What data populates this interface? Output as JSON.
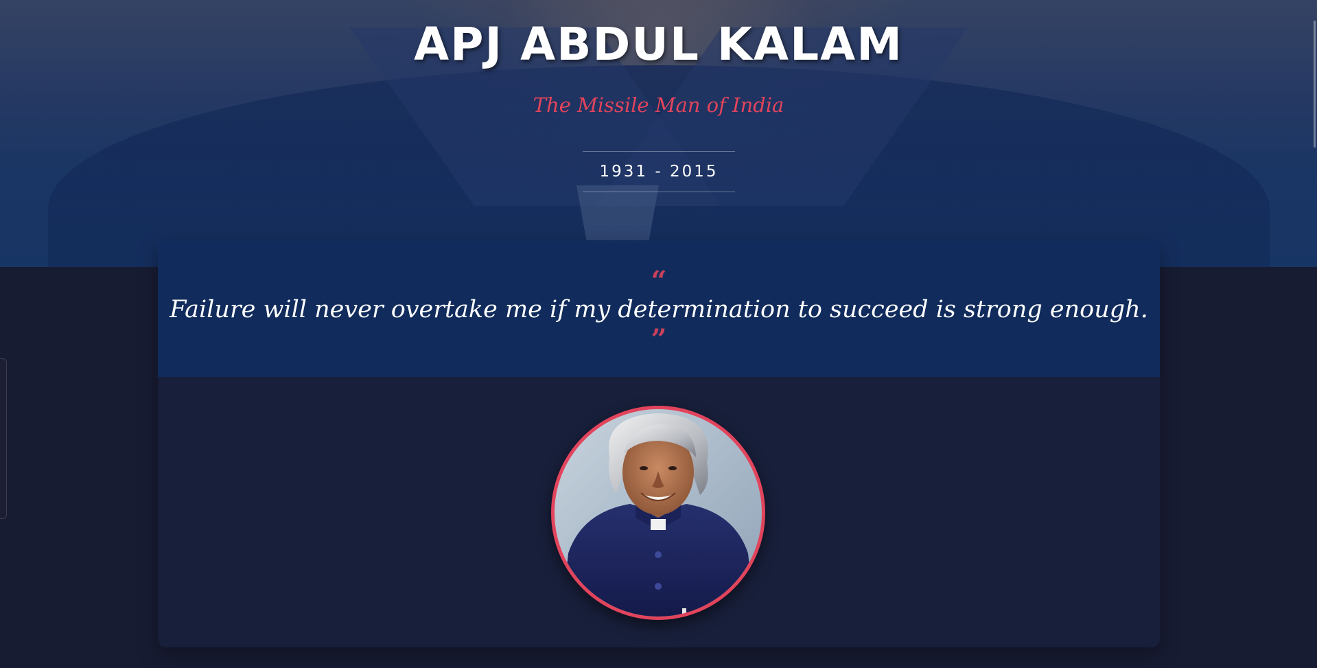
{
  "hero": {
    "title": "APJ ABDUL KALAM",
    "subtitle": "The Missile Man of India",
    "years": "1931 - 2015"
  },
  "quote": {
    "open_mark": "“",
    "text": "Failure will never overtake me if my determination to succeed is strong enough.",
    "close_mark": "”"
  },
  "colors": {
    "accent": "#e2445c",
    "page_background": "#181c33",
    "quote_band": "#112c5c",
    "card_background": "#181f3a"
  },
  "portrait": {
    "icon": "portrait-photo"
  }
}
